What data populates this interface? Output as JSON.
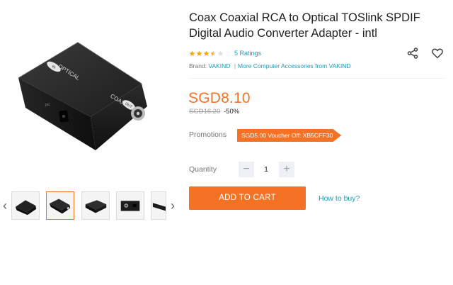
{
  "product": {
    "title": "Coax Coaxial RCA to Optical TOSlink SPDIF Digital Audio Converter Adapter - intl",
    "rating_value": 3.5,
    "rating_max": 5,
    "ratings_link": "5 Ratings",
    "brand_label": "Brand:",
    "brand_name": "VAKIND",
    "brand_separator": "|",
    "more_accessories": "More Computer Accessories from VAKIND",
    "price": "SGD8.10",
    "original_price": "SGD16.20",
    "discount": "-50%",
    "image_labels": {
      "top": "OPTICAL",
      "front": "COAXIAL",
      "in": "IN",
      "out": "OUT",
      "dc": "DC"
    }
  },
  "promotions": {
    "label": "Promotions",
    "voucher": "SGD5.00 Voucher Off: XB5OFF30"
  },
  "quantity": {
    "label": "Quantity",
    "minus": "−",
    "plus": "+",
    "value": "1"
  },
  "actions": {
    "add_to_cart": "ADD TO CART",
    "how_to_buy": "How to buy?"
  },
  "gallery": {
    "prev_arrow": "‹",
    "next_arrow": "›",
    "thumbnails_count": 5,
    "active_index": 1
  },
  "colors": {
    "accent": "#f57224",
    "link": "#1a9cb7",
    "star": "#f7a400"
  },
  "icons": {
    "share": "share-icon",
    "wishlist": "heart-icon",
    "star": "star-icon"
  }
}
